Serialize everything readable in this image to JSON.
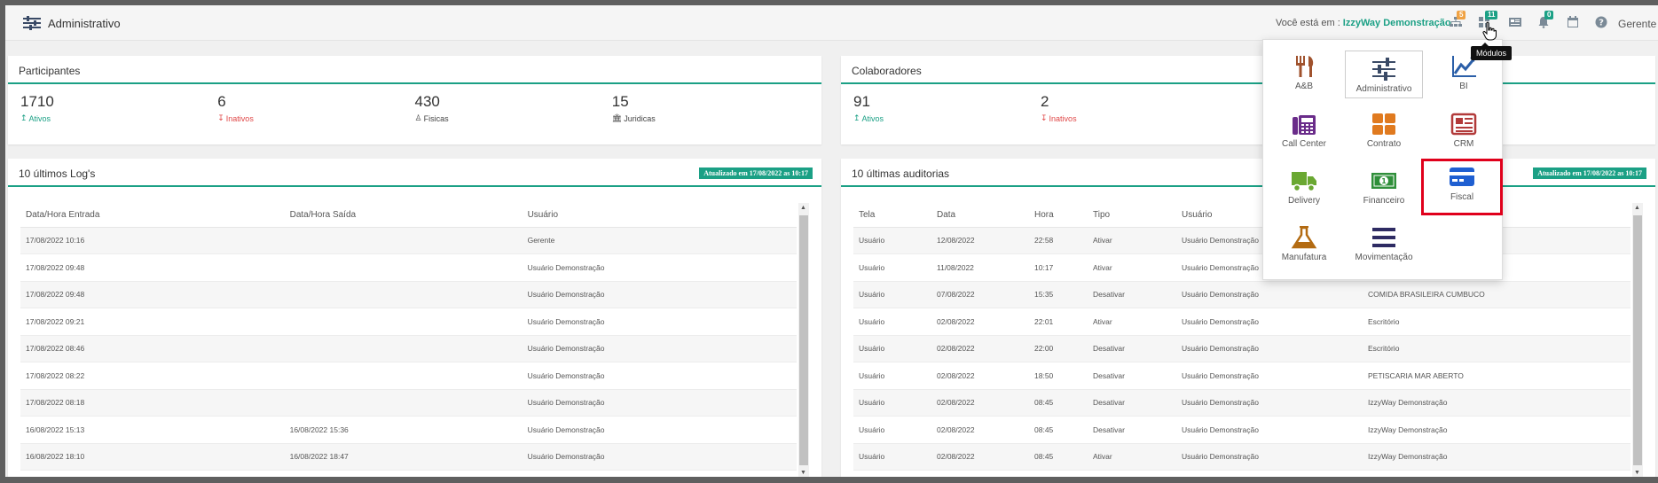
{
  "header": {
    "title": "Administrativo",
    "you_are_in": "Você está em :",
    "company": "IzzyWay Demonstração",
    "user": "Gerente",
    "badges": {
      "sitemap": "5",
      "modules": "11",
      "bell": "0"
    },
    "colors": {
      "accent": "#1ba085",
      "badge_orange": "#f0a243",
      "badge_green": "#1ba085",
      "danger": "#e04848"
    }
  },
  "tooltip": "Módulos",
  "participantes": {
    "title": "Participantes",
    "stats": [
      {
        "value": "1710",
        "label": "Ativos"
      },
      {
        "value": "6",
        "label": "Inativos"
      },
      {
        "value": "430",
        "label": "Fisicas"
      },
      {
        "value": "15",
        "label": "Juridicas"
      }
    ]
  },
  "colaboradores": {
    "title": "Colaboradores",
    "stats": [
      {
        "value": "91",
        "label": "Ativos"
      },
      {
        "value": "2",
        "label": "Inativos"
      }
    ]
  },
  "logs": {
    "title": "10 últimos Log's",
    "updated": "Atualizado em 17/08/2022 as 10:17",
    "columns": [
      "Data/Hora Entrada",
      "Data/Hora Saída",
      "Usuário"
    ],
    "rows": [
      [
        "17/08/2022 10:16",
        "",
        "Gerente"
      ],
      [
        "17/08/2022 09:48",
        "",
        "Usuário Demonstração"
      ],
      [
        "17/08/2022 09:48",
        "",
        "Usuário Demonstração"
      ],
      [
        "17/08/2022 09:21",
        "",
        "Usuário Demonstração"
      ],
      [
        "17/08/2022 08:46",
        "",
        "Usuário Demonstração"
      ],
      [
        "17/08/2022 08:22",
        "",
        "Usuário Demonstração"
      ],
      [
        "17/08/2022 08:18",
        "",
        "Usuário Demonstração"
      ],
      [
        "16/08/2022 15:13",
        "16/08/2022 15:36",
        "Usuário Demonstração"
      ],
      [
        "16/08/2022 18:10",
        "16/08/2022 18:47",
        "Usuário Demonstração"
      ]
    ]
  },
  "auditorias": {
    "title": "10 últimas auditorias",
    "updated": "Atualizado em 17/08/2022 as 10:17",
    "columns": [
      "Tela",
      "Data",
      "Hora",
      "Tipo",
      "Usuário",
      ""
    ],
    "rows": [
      [
        "Usuário",
        "12/08/2022",
        "22:58",
        "Ativar",
        "Usuário Demonstração",
        ""
      ],
      [
        "Usuário",
        "11/08/2022",
        "10:17",
        "Ativar",
        "Usuário Demonstração",
        ""
      ],
      [
        "Usuário",
        "07/08/2022",
        "15:35",
        "Desativar",
        "Usuário Demonstração",
        "COMIDA BRASILEIRA CUMBUCO"
      ],
      [
        "Usuário",
        "02/08/2022",
        "22:01",
        "Ativar",
        "Usuário Demonstração",
        "Escritório"
      ],
      [
        "Usuário",
        "02/08/2022",
        "22:00",
        "Desativar",
        "Usuário Demonstração",
        "Escritório"
      ],
      [
        "Usuário",
        "02/08/2022",
        "18:50",
        "Desativar",
        "Usuário Demonstração",
        "PETISCARIA MAR ABERTO"
      ],
      [
        "Usuário",
        "02/08/2022",
        "08:45",
        "Desativar",
        "Usuário Demonstração",
        "IzzyWay Demonstração"
      ],
      [
        "Usuário",
        "02/08/2022",
        "08:45",
        "Desativar",
        "Usuário Demonstração",
        "IzzyWay Demonstração"
      ],
      [
        "Usuário",
        "02/08/2022",
        "08:45",
        "Ativar",
        "Usuário Demonstração",
        "IzzyWay Demonstração"
      ]
    ]
  },
  "modules": [
    {
      "label": "A&B",
      "icon": "fork-knife-icon",
      "color": "#a0522d"
    },
    {
      "label": "Administrativo",
      "icon": "sliders-icon",
      "color": "#3a4a66"
    },
    {
      "label": "BI",
      "icon": "line-chart-icon",
      "color": "#2b5fa8"
    },
    {
      "label": "Call Center",
      "icon": "phone-icon",
      "color": "#6a2c8a"
    },
    {
      "label": "Contrato",
      "icon": "grid-icon",
      "color": "#e07a1f"
    },
    {
      "label": "CRM",
      "icon": "newspaper-icon",
      "color": "#b23a3a"
    },
    {
      "label": "Delivery",
      "icon": "truck-icon",
      "color": "#6aa832"
    },
    {
      "label": "Financeiro",
      "icon": "money-icon",
      "color": "#2f8f3a"
    },
    {
      "label": "Fiscal",
      "icon": "credit-card-icon",
      "color": "#1f5fd1"
    },
    {
      "label": "Manufatura",
      "icon": "flask-icon",
      "color": "#b36b12"
    },
    {
      "label": "Movimentação",
      "icon": "bars-icon",
      "color": "#2e2b63"
    }
  ]
}
